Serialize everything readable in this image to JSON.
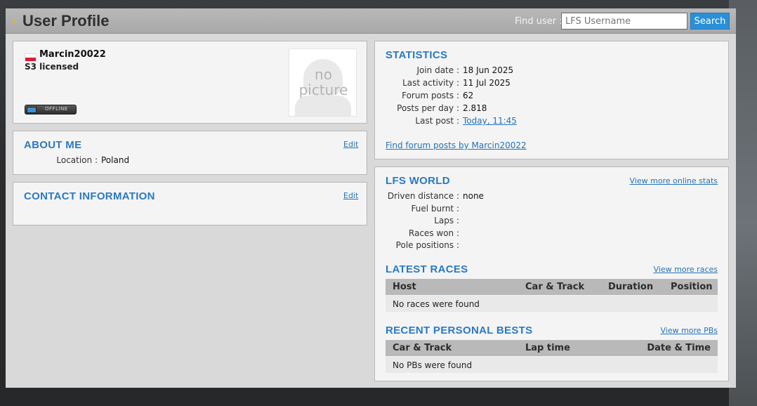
{
  "header": {
    "title": "User Profile",
    "find_label": "Find user :",
    "search_placeholder": "LFS Username",
    "search_button": "Search"
  },
  "profile": {
    "username": "Marcin20022",
    "license": "S3 licensed",
    "status": "OFFLINE",
    "picture_text_1": "no",
    "picture_text_2": "picture"
  },
  "about_me": {
    "heading": "ABOUT ME",
    "edit_label": "Edit",
    "fields": [
      {
        "label": "Location :",
        "value": "Poland"
      }
    ]
  },
  "contact": {
    "heading": "CONTACT INFORMATION",
    "edit_label": "Edit"
  },
  "statistics": {
    "heading": "STATISTICS",
    "rows": [
      {
        "label": "Join date :",
        "value": "18 Jun 2025"
      },
      {
        "label": "Last activity :",
        "value": "11 Jul 2025"
      },
      {
        "label": "Forum posts :",
        "value": "62"
      },
      {
        "label": "Posts per day :",
        "value": "2.818"
      },
      {
        "label": "Last post :",
        "value": "Today, 11:45"
      }
    ],
    "find_posts_link": "Find forum posts by Marcin20022"
  },
  "lfs_world": {
    "heading": "LFS WORLD",
    "more_link": "View more online stats",
    "rows": [
      {
        "label": "Driven distance :",
        "value": "none"
      },
      {
        "label": "Fuel burnt :",
        "value": ""
      },
      {
        "label": "Laps :",
        "value": ""
      },
      {
        "label": "Races won :",
        "value": ""
      },
      {
        "label": "Pole positions :",
        "value": ""
      }
    ]
  },
  "latest_races": {
    "heading": "LATEST RACES",
    "more_link": "View more races",
    "columns": [
      "Host",
      "Car & Track",
      "Duration",
      "Position"
    ],
    "empty_text": "No races were found"
  },
  "personal_bests": {
    "heading": "RECENT PERSONAL BESTS",
    "more_link": "View more PBs",
    "columns": [
      "Car & Track",
      "Lap time",
      "Date & Time"
    ],
    "empty_text": "No PBs were found"
  },
  "colors": {
    "accent_blue": "#2a79c4",
    "link_blue": "#2373b8",
    "search_button": "#2a8fd6",
    "flag_red": "#dc1e35",
    "title_chevron": "#f2b11e"
  }
}
